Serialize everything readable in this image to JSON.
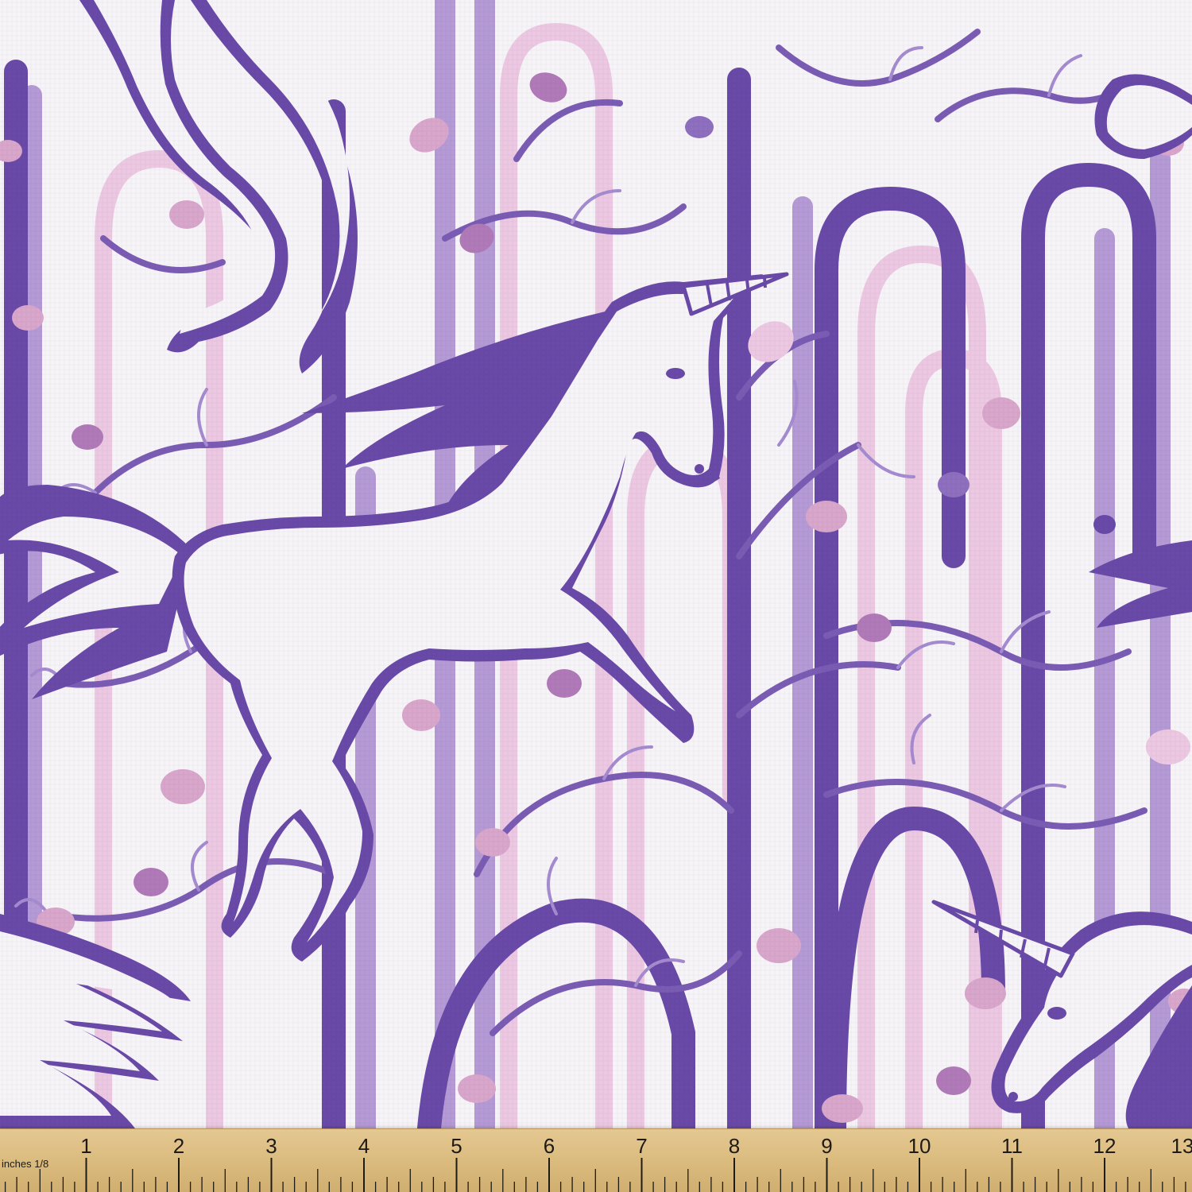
{
  "colors": {
    "background": "#f7f4f8",
    "dark_purple": "#6a4aa8",
    "mid_purple": "#8e6fc0",
    "lavender": "#b59ad6",
    "pink": "#d9a6cc",
    "light_pink": "#ecc8e2",
    "ruler_wood": "#dcbc80",
    "ruler_ink": "#1e1a14"
  },
  "ruler": {
    "unit_label": "inches",
    "fraction_label": "1/8",
    "numbers": [
      "1",
      "2",
      "3",
      "4",
      "5",
      "6",
      "7",
      "8",
      "9",
      "10",
      "11",
      "12",
      "13"
    ]
  }
}
